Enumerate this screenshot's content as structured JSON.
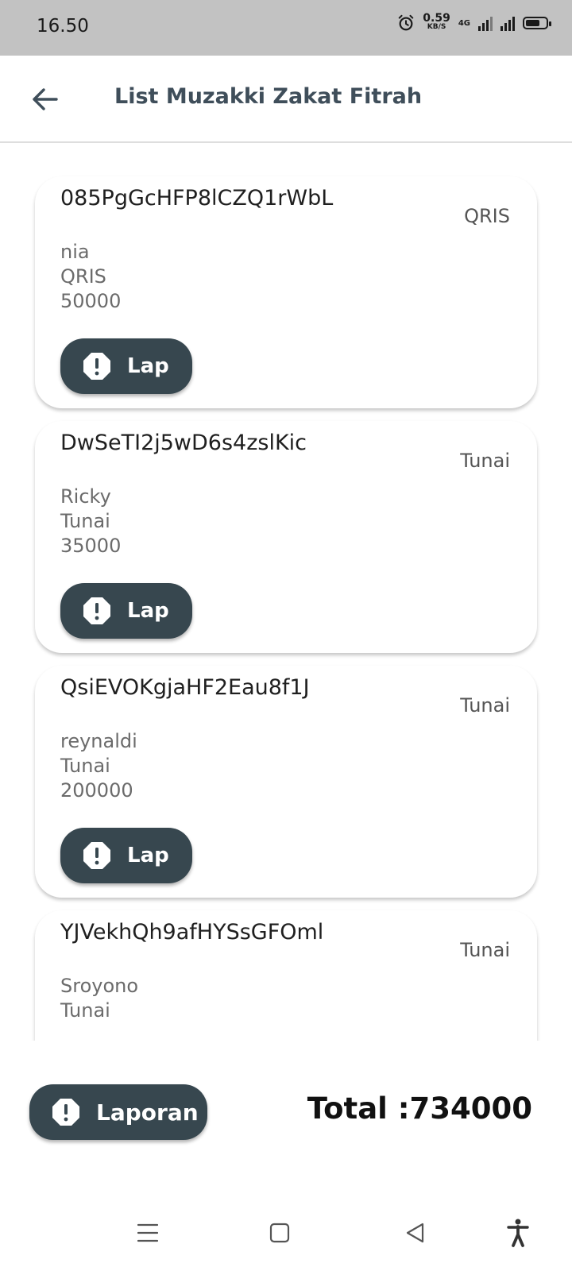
{
  "status_bar": {
    "time": "16.50",
    "net_speed_value": "0.59",
    "net_speed_unit": "KB/S",
    "network_type": "4G",
    "icons": [
      "alarm-icon",
      "signal-icon",
      "battery-icon"
    ]
  },
  "app_bar": {
    "title": "List Muzakki Zakat Fitrah",
    "back_icon": "arrow-left-icon"
  },
  "items": [
    {
      "id": "085PgGcHFP8lCZQ1rWbL",
      "method_right": "QRIS",
      "name": "nia",
      "method": "QRIS",
      "amount": "50000",
      "button_label": "Lap"
    },
    {
      "id": "DwSeTI2j5wD6s4zslKic",
      "method_right": "Tunai",
      "name": "Ricky",
      "method": "Tunai",
      "amount": "35000",
      "button_label": "Lap"
    },
    {
      "id": "QsiEVOKgjaHF2Eau8f1J",
      "method_right": "Tunai",
      "name": "reynaldi",
      "method": "Tunai",
      "amount": "200000",
      "button_label": "Lap"
    },
    {
      "id": "YJVekhQh9afHYSsGFOml",
      "method_right": "Tunai",
      "name": "Sroyono",
      "method": "Tunai",
      "amount": "",
      "button_label": ""
    }
  ],
  "footer": {
    "report_button_label": "Laporan",
    "total_text": "Total :734000"
  },
  "nav_bar": {
    "icons": [
      "menu-icon",
      "home-square-icon",
      "back-triangle-icon",
      "accessibility-icon"
    ]
  },
  "colors": {
    "status_bar_bg": "#c2c2c2",
    "button_bg": "#37474f",
    "title_text": "#3f4e5a"
  }
}
